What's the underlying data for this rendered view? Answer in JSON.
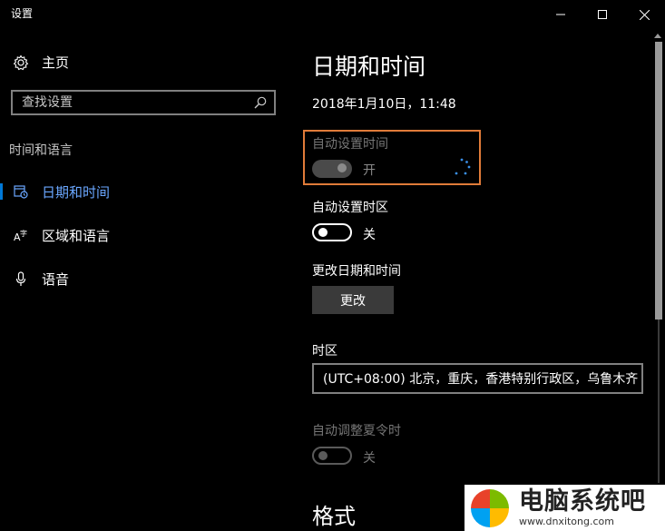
{
  "window": {
    "title": "设置",
    "minimize_icon": "minimize-icon",
    "maximize_icon": "maximize-icon",
    "close_icon": "close-icon"
  },
  "sidebar": {
    "home_label": "主页",
    "search_placeholder": "查找设置",
    "section_label": "时间和语言",
    "items": [
      {
        "label": "日期和时间",
        "icon": "calendar-clock-icon",
        "active": true
      },
      {
        "label": "区域和语言",
        "icon": "language-icon",
        "active": false
      },
      {
        "label": "语音",
        "icon": "microphone-icon",
        "active": false
      }
    ]
  },
  "main": {
    "title": "日期和时间",
    "current_datetime": "2018年1月10日，11:48",
    "auto_time": {
      "label": "自动设置时间",
      "state": "开"
    },
    "auto_timezone": {
      "label": "自动设置时区",
      "state": "关"
    },
    "change_datetime": {
      "label": "更改日期和时间",
      "button": "更改"
    },
    "timezone": {
      "label": "时区",
      "value": "(UTC+08:00) 北京，重庆，香港特别行政区，乌鲁木齐"
    },
    "auto_dst": {
      "label": "自动调整夏令时",
      "state": "关"
    },
    "format_heading": "格式"
  },
  "colors": {
    "accent": "#0078d7",
    "highlight_border": "#e07b39",
    "background": "#000000"
  },
  "watermark": {
    "title": "电脑系统吧",
    "url": "www.dnxitong.com"
  }
}
